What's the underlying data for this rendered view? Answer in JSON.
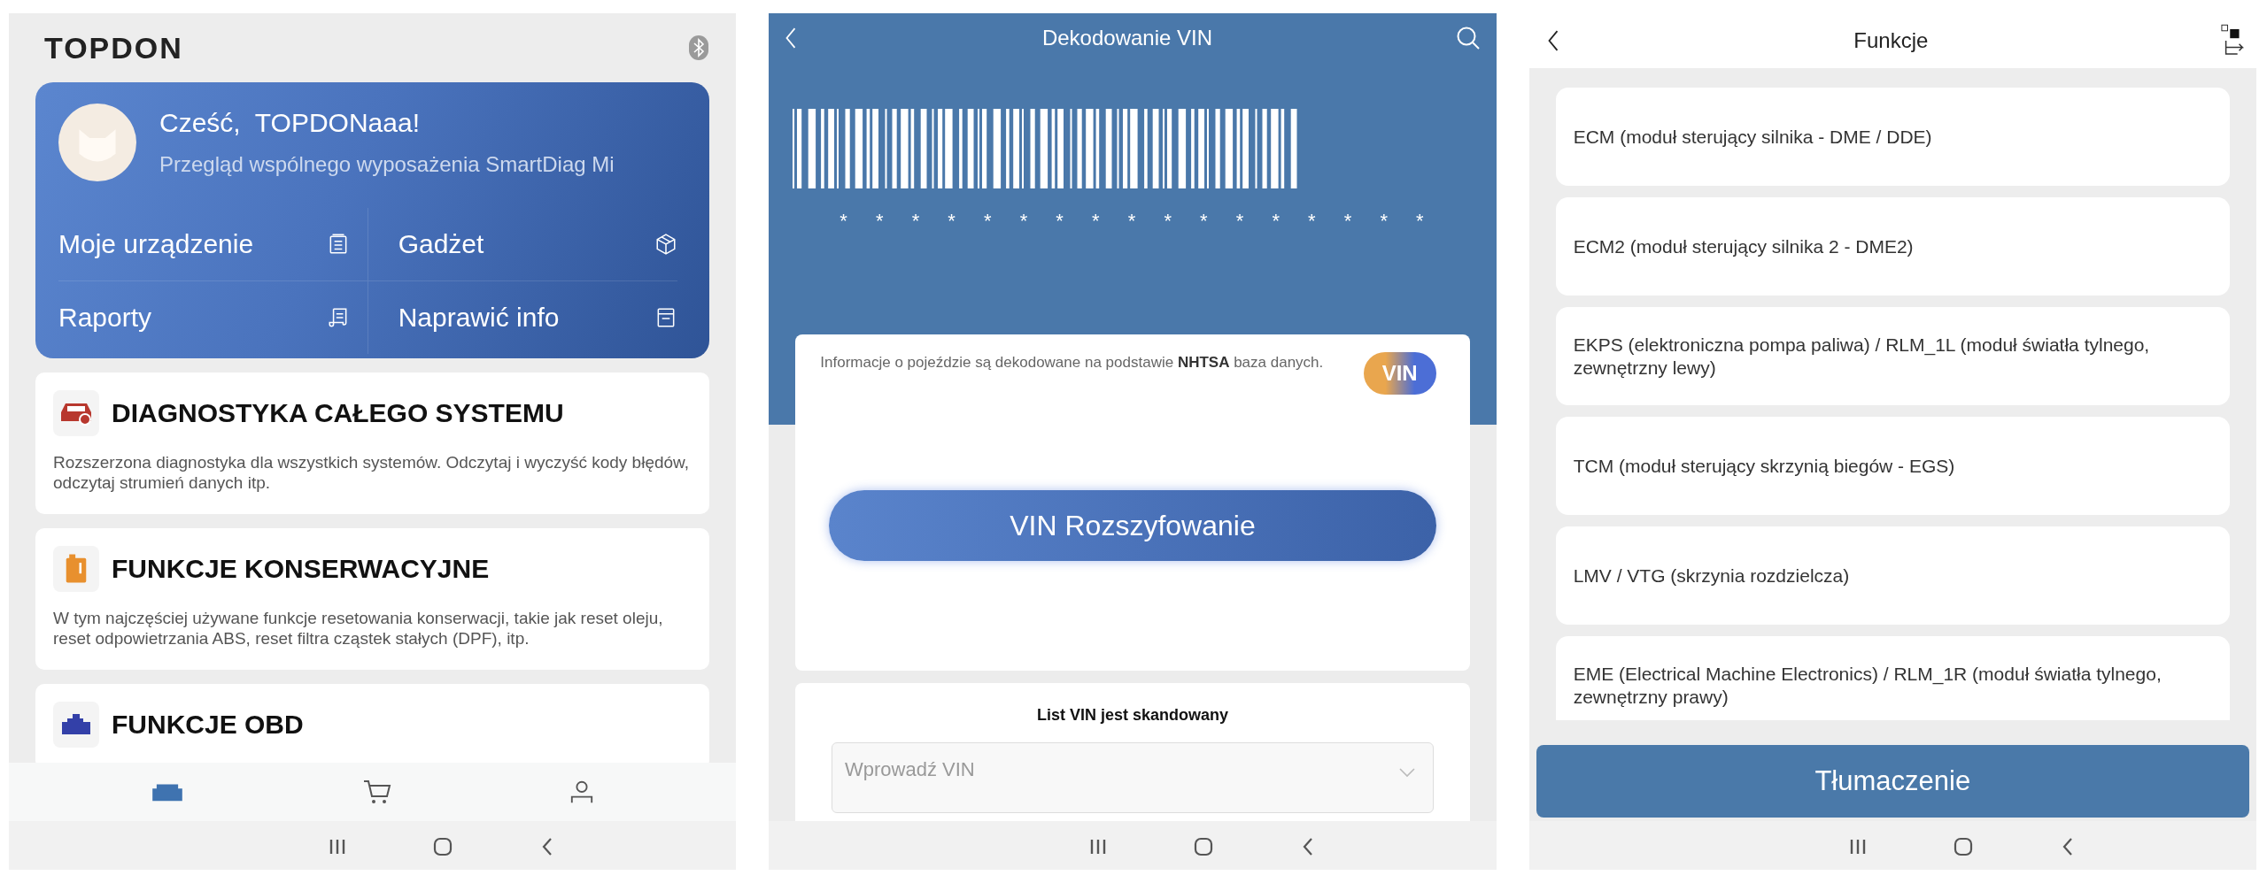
{
  "home": {
    "logo": "TOPDON",
    "greeting": "Cześć,  TOPDONaaa!",
    "subtitle": "Przegląd wspólnego wyposażenia SmartDiag Mi",
    "quick_links": [
      {
        "label": "Moje urządzenie",
        "kind": "device"
      },
      {
        "label": "Gadżet",
        "kind": "gadget"
      },
      {
        "label": "Raporty",
        "kind": "reports"
      },
      {
        "label": "Naprawić info",
        "kind": "repair"
      }
    ],
    "modules": [
      {
        "title": "DIAGNOSTYKA CAŁEGO SYSTEMU",
        "description": "Rozszerzona diagnostyka dla wszystkich systemów. Odczytaj i wyczyść kody błędów, odczytaj strumień danych itp.",
        "kind": "diagnostics"
      },
      {
        "title": "FUNKCJE KONSERWACYJNE",
        "description": "W tym najczęściej używane funkcje resetowania konserwacji, takie jak reset oleju, reset odpowietrzania ABS, reset filtra cząstek stałych (DPF), itp.",
        "kind": "maintenance"
      },
      {
        "title": "FUNKCJE OBD",
        "kind": "obd"
      }
    ],
    "bottom_tabs": [
      {
        "kind": "vehicle",
        "selected": true
      },
      {
        "kind": "shop",
        "selected": false
      },
      {
        "kind": "profile",
        "selected": false
      }
    ]
  },
  "vin_decoding": {
    "title": "Dekodowanie VIN",
    "vin_mask": "* * * * * * * * * * * * * * * * *",
    "info": "Informacje o pojeździe są dekodowane na podstawie **NHTSA** baza danych.",
    "badge": "VIN",
    "button": "VIN Rozszyfowanie",
    "list_title": "List VIN jest skandowany",
    "input": {
      "placeholder": "Wprowadź VIN"
    }
  },
  "functions": {
    "title": "Funkcje",
    "items": [
      "ECM (moduł sterujący silnika - DME / DDE)",
      "ECM2 (moduł sterujący silnika 2 - DME2)",
      "EKPS (elektroniczna pompa paliwa) / RLM_1L (moduł światła tylnego, zewnętrzny lewy)",
      "TCM (moduł sterujący skrzynią biegów - EGS)",
      "LMV / VTG (skrzynia rozdzielcza)",
      "EME (Electrical Machine Electronics) / RLM_1R (moduł światła tylnego, zewnętrzny prawy)"
    ],
    "button": "Tłumaczenie"
  }
}
